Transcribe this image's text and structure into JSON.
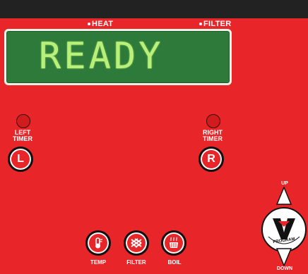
{
  "indicators": {
    "heat_label": "HEAT",
    "filter_label": "FILTER"
  },
  "display": {
    "text": "READY"
  },
  "left_timer": {
    "label_line1": "LEFT",
    "label_line2": "TIMER",
    "button": "L"
  },
  "right_timer": {
    "label_line1": "RIGHT",
    "label_line2": "TIMER",
    "button": "R"
  },
  "controls": {
    "up_label": "UP",
    "down_label": "DOWN",
    "program_label": "PROGRAM",
    "logo": "V"
  },
  "buttons": [
    {
      "label": "TEMP",
      "icon": "thermometer-icon"
    },
    {
      "label": "FILTER",
      "icon": "filter-icon"
    },
    {
      "label": "BOIL",
      "icon": "boil-icon"
    }
  ],
  "colors": {
    "panel_red": "#e8262a",
    "display_green": "#2d7a3a",
    "segment_green": "#b8f07a",
    "top_bar": "#222222"
  }
}
